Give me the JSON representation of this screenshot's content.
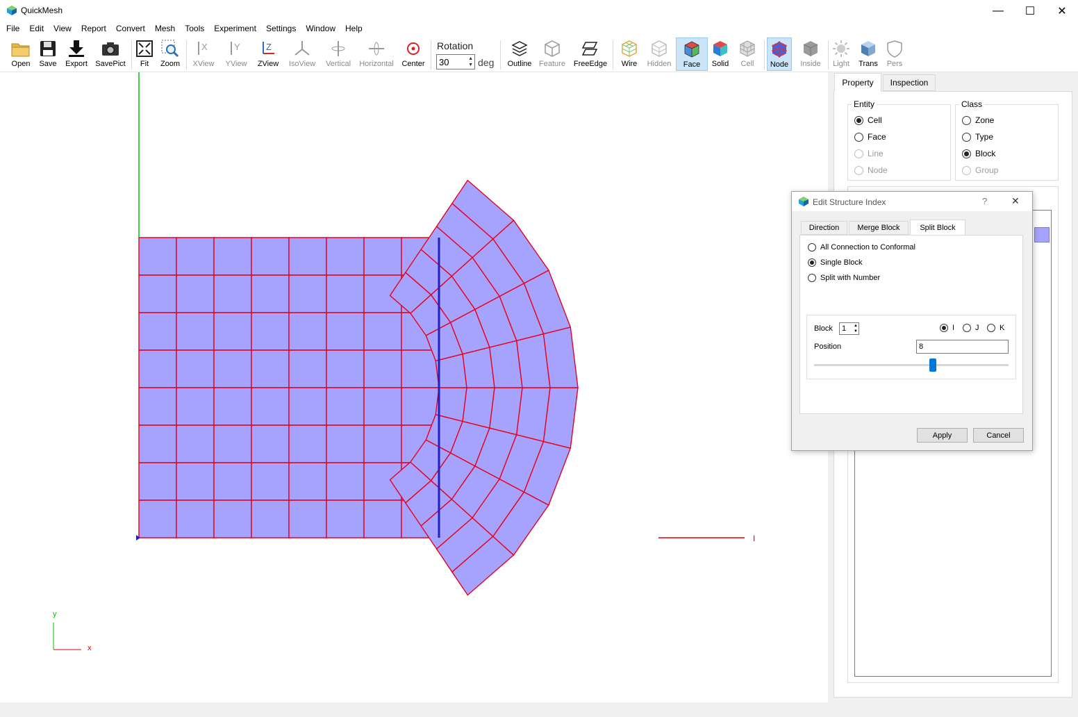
{
  "app": {
    "title": "QuickMesh"
  },
  "window_controls": {
    "minimize": "—",
    "maximize": "☐",
    "close": "✕"
  },
  "menu": [
    "File",
    "Edit",
    "View",
    "Report",
    "Convert",
    "Mesh",
    "Tools",
    "Experiment",
    "Settings",
    "Window",
    "Help"
  ],
  "toolbar": {
    "open": "Open",
    "save": "Save",
    "export": "Export",
    "savepict": "SavePict",
    "fit": "Fit",
    "zoom": "Zoom",
    "xview": "XView",
    "yview": "YView",
    "zview": "ZView",
    "isoview": "IsoView",
    "vertical": "Vertical",
    "horizontal": "Horizontal",
    "center": "Center",
    "rotation_label": "Rotation",
    "rotation_value": "30",
    "rotation_unit": "deg",
    "outline": "Outline",
    "feature": "Feature",
    "freeedge": "FreeEdge",
    "wire": "Wire",
    "hidden": "Hidden",
    "face": "Face",
    "solid": "Solid",
    "cell": "Cell",
    "node": "Node",
    "inside": "Inside",
    "light": "Light",
    "trans": "Trans",
    "pers": "Pers"
  },
  "viewport": {
    "axis_i_label": "I",
    "triad_y": "y",
    "triad_x": "x",
    "colors": {
      "mesh_fill": "#a6a3ff",
      "mesh_edge": "#e8001f",
      "axis_green": "#00c000",
      "axis_red": "#e00000"
    }
  },
  "panel": {
    "tabs": [
      "Property",
      "Inspection"
    ],
    "entity": {
      "title": "Entity",
      "options": [
        "Cell",
        "Face",
        "Line",
        "Node"
      ],
      "selected": "Cell"
    },
    "class": {
      "title": "Class",
      "options": [
        "Zone",
        "Type",
        "Block",
        "Group"
      ],
      "selected": "Block"
    }
  },
  "dialog": {
    "title": "Edit Structure Index",
    "help": "?",
    "close": "✕",
    "tabs": [
      "Direction",
      "Merge Block",
      "Split Block"
    ],
    "selected_tab": "Split Block",
    "modes": [
      "All Connection to Conformal",
      "Single Block",
      "Split with Number"
    ],
    "selected_mode": "Single Block",
    "block_label": "Block",
    "block_value": "1",
    "axes": [
      "I",
      "J",
      "K"
    ],
    "selected_axis": "I",
    "position_label": "Position",
    "position_value": "8",
    "slider_fraction": 0.61,
    "apply": "Apply",
    "cancel": "Cancel"
  }
}
